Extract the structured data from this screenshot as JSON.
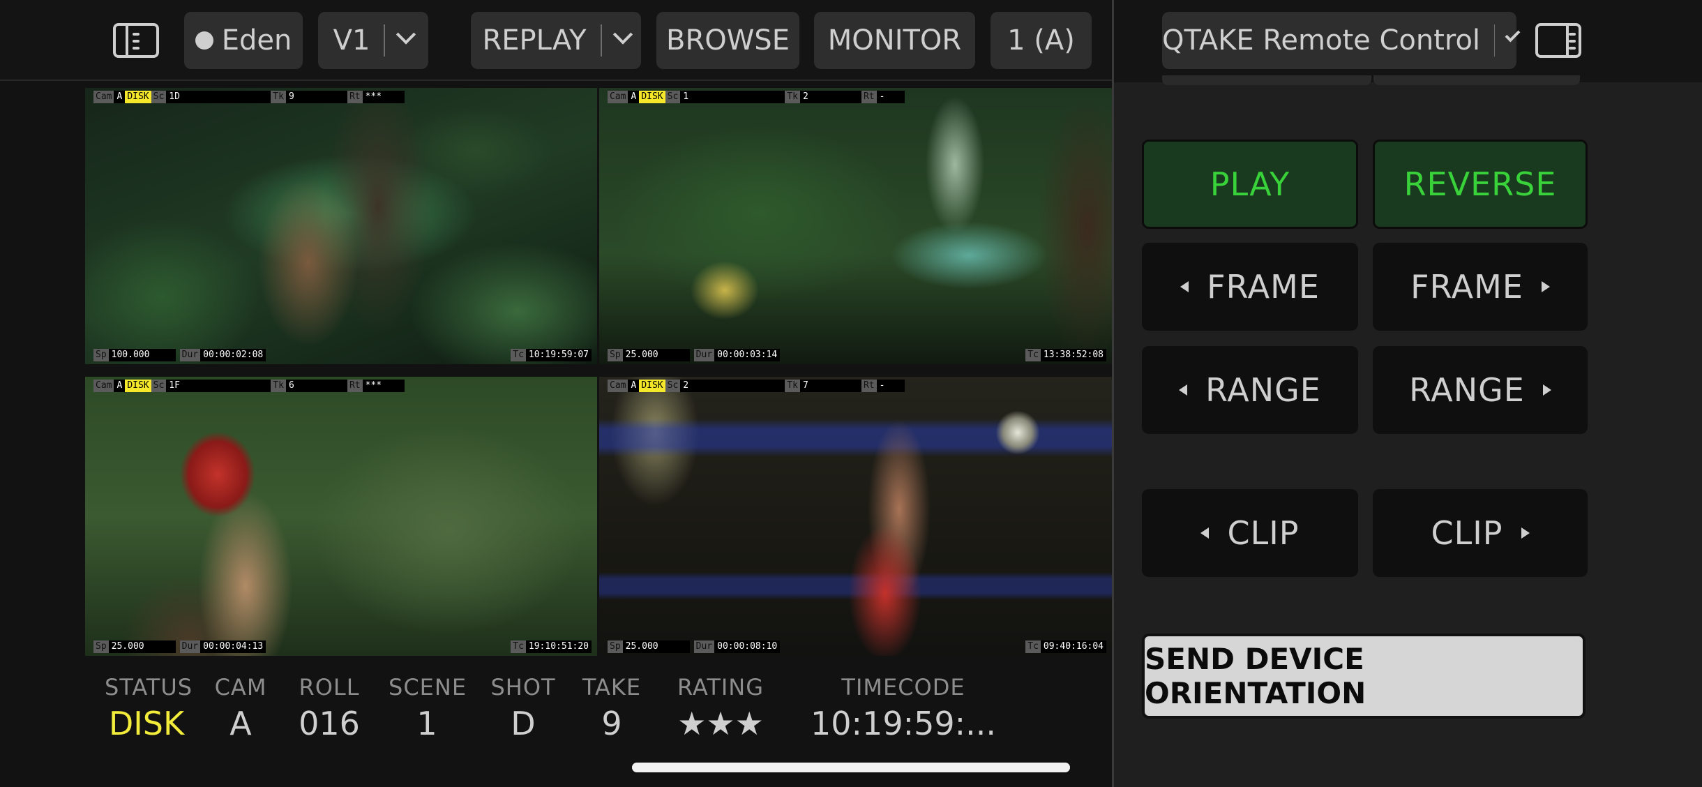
{
  "toolbar": {
    "profile_label": "Eden",
    "version_label": "V1",
    "replay_label": "REPLAY",
    "browse_label": "BROWSE",
    "monitor_label": "MONITOR",
    "view_label": "1 (A)"
  },
  "remote": {
    "title": "QTAKE Remote Control",
    "play_label": "PLAY",
    "reverse_label": "REVERSE",
    "frame_back_label": "FRAME",
    "frame_fwd_label": "FRAME",
    "range_back_label": "RANGE",
    "range_fwd_label": "RANGE",
    "clip_back_label": "CLIP",
    "clip_fwd_label": "CLIP",
    "send_orientation_label": "SEND DEVICE ORIENTATION",
    "accent_green": "#39d23a"
  },
  "overlay_labels": {
    "cam": "Cam",
    "sc": "Sc",
    "tk": "Tk",
    "rt": "Rt",
    "sp": "Sp",
    "dur": "Dur",
    "tc": "Tc"
  },
  "clips": [
    {
      "cam": "A",
      "status": "DISK",
      "scene": "1D",
      "take": "9",
      "rating": "***",
      "speed": "100.000",
      "duration": "00:00:02:08",
      "timecode": "10:19:59:07"
    },
    {
      "cam": "A",
      "status": "DISK",
      "scene": "1",
      "take": "2",
      "rating": "-",
      "speed": "25.000",
      "duration": "00:00:03:14",
      "timecode": "13:38:52:08"
    },
    {
      "cam": "A",
      "status": "DISK",
      "scene": "1F",
      "take": "6",
      "rating": "***",
      "speed": "25.000",
      "duration": "00:00:04:13",
      "timecode": "19:10:51:20"
    },
    {
      "cam": "A",
      "status": "DISK",
      "scene": "2",
      "take": "7",
      "rating": "-",
      "speed": "25.000",
      "duration": "00:00:08:10",
      "timecode": "09:40:16:04"
    }
  ],
  "metadata": {
    "headers": {
      "status": "STATUS",
      "cam": "CAM",
      "roll": "ROLL",
      "scene": "SCENE",
      "shot": "SHOT",
      "take": "TAKE",
      "rating": "RATING",
      "timecode": "TIMECODE"
    },
    "values": {
      "status": "DISK",
      "cam": "A",
      "roll": "016",
      "scene": "1",
      "shot": "D",
      "take": "9",
      "rating": "★★★",
      "timecode": "10:19:59:..."
    },
    "status_color": "#f2ec3a"
  }
}
